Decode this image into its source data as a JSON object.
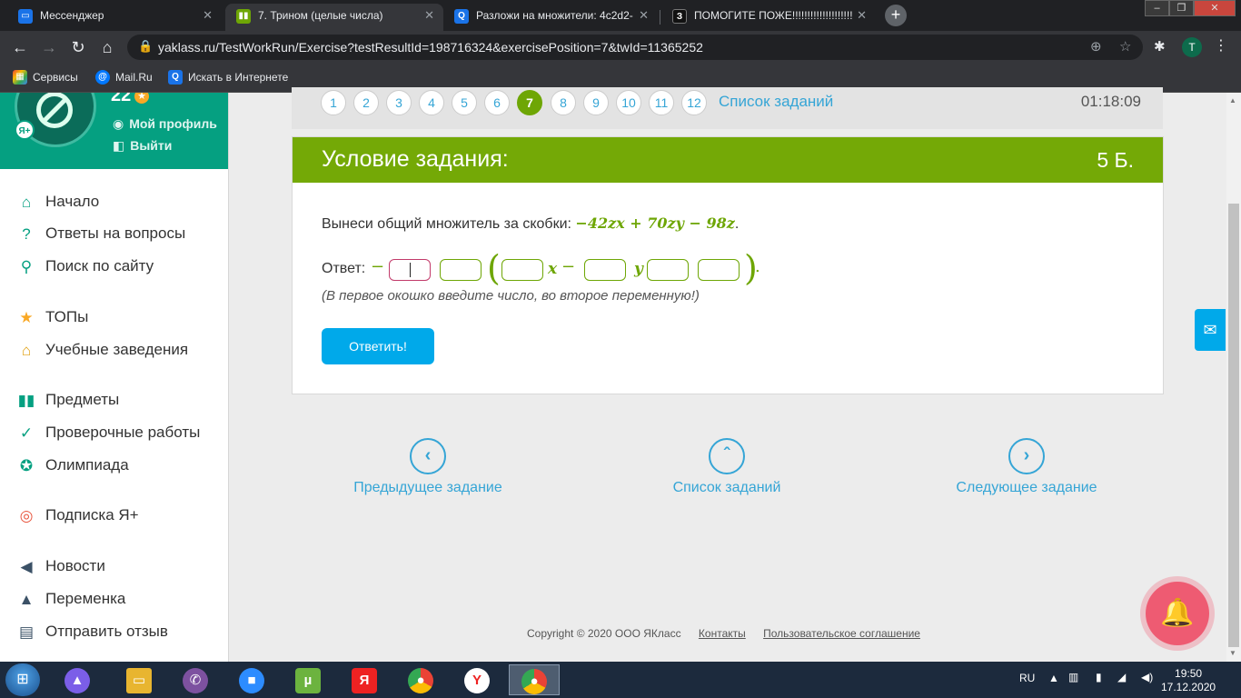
{
  "browser": {
    "tabs": [
      {
        "title": "Мессенджер",
        "icon": "messenger-icon",
        "color": "#1a73e8"
      },
      {
        "title": "7. Трином (целые числа)",
        "icon": "yaklass-icon",
        "color": "#6ea605"
      },
      {
        "title": "Разложи на множители: 4с2d2-",
        "icon": "search-icon",
        "color": "#1a73e8"
      },
      {
        "title": "ПОМОГИТЕ ПОЖЕ!!!!!!!!!!!!!!!!!!!!",
        "icon": "znanija-icon",
        "color": "#222"
      }
    ],
    "url": "yaklass.ru/TestWorkRun/Exercise?testResultId=198716324&exercisePosition=7&twId=11365252",
    "bookmarks": [
      {
        "label": "Сервисы",
        "icon": "apps-grid-icon"
      },
      {
        "label": "Mail.Ru",
        "icon": "mailru-icon"
      },
      {
        "label": "Искать в Интернете",
        "icon": "search-icon"
      }
    ],
    "profile_letter": "T"
  },
  "sidebar": {
    "score": "22",
    "ya_badge": "Я+",
    "profile_link": "Мой профиль",
    "logout_link": "Выйти",
    "menu": [
      {
        "label": "Начало",
        "icon": "home-icon"
      },
      {
        "label": "Ответы на вопросы",
        "icon": "question-icon"
      },
      {
        "label": "Поиск по сайту",
        "icon": "search-icon"
      },
      {
        "label": "ТОПы",
        "icon": "star-icon"
      },
      {
        "label": "Учебные заведения",
        "icon": "institution-icon"
      },
      {
        "label": "Предметы",
        "icon": "books-icon"
      },
      {
        "label": "Проверочные работы",
        "icon": "check-circle-icon"
      },
      {
        "label": "Олимпиада",
        "icon": "medal-icon"
      },
      {
        "label": "Подписка Я+",
        "icon": "subscription-icon"
      },
      {
        "label": "Новости",
        "icon": "megaphone-icon"
      },
      {
        "label": "Переменка",
        "icon": "bell-icon"
      },
      {
        "label": "Отправить отзыв",
        "icon": "feedback-icon"
      }
    ]
  },
  "exercise_nav": {
    "numbers": [
      "1",
      "2",
      "3",
      "4",
      "5",
      "6",
      "7",
      "8",
      "9",
      "10",
      "11",
      "12"
    ],
    "current": "7",
    "task_list_label": "Список заданий",
    "timer": "01:18:09"
  },
  "task": {
    "header": "Условие задания:",
    "points": "5 Б.",
    "question_text": "Вынеси общий множитель за скобки: ",
    "expression": "−42zx + 70zy − 98z",
    "answer_label": "Ответ: ",
    "minus1": "−",
    "var_x": "x",
    "minus2": "−",
    "var_y": "y",
    "hint": "(В первое окошко введите число, во второе переменную!)",
    "submit_label": "Ответить!",
    "input_values": [
      "",
      "",
      "",
      "",
      "",
      ""
    ]
  },
  "bottom_nav": {
    "prev": "Предыдущее задание",
    "list": "Список заданий",
    "next": "Следующее задание"
  },
  "footer": {
    "copyright": "Copyright © 2020 ООО ЯКласс",
    "contacts": "Контакты",
    "agreement": "Пользовательское соглашение"
  },
  "taskbar": {
    "language": "RU",
    "time": "19:50",
    "date": "17.12.2020"
  }
}
